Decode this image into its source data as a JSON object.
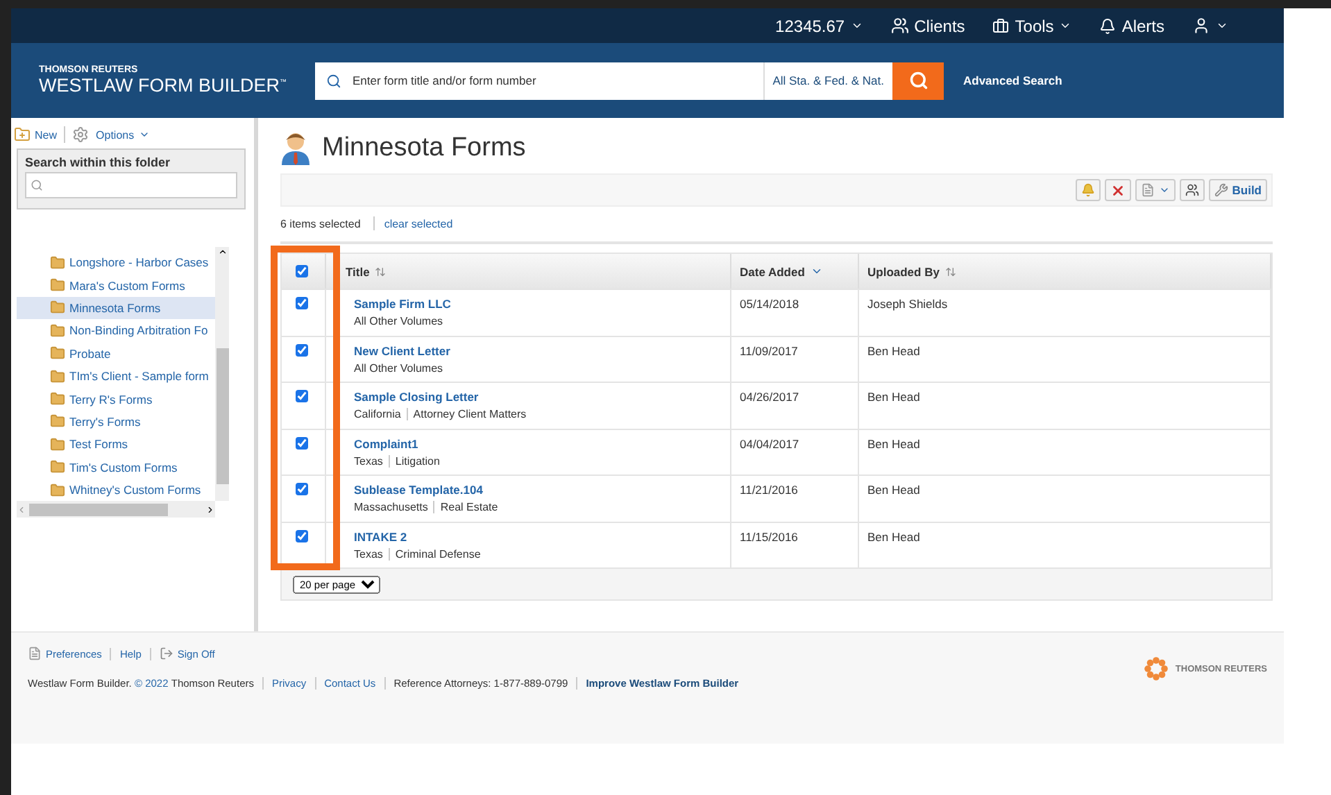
{
  "topbar": {
    "account": "12345.67",
    "items": [
      {
        "kind": "clients",
        "label": "Clients"
      },
      {
        "kind": "tools",
        "label": "Tools"
      },
      {
        "kind": "alerts",
        "label": "Alerts"
      },
      {
        "kind": "user"
      }
    ]
  },
  "header": {
    "brand_top": "THOMSON REUTERS",
    "brand": "WESTLAW FORM BUILDER",
    "tm": "™",
    "search": {
      "placeholder": "Enter form title and/or form number"
    },
    "scope": "All Sta. & Fed. & Nat.",
    "advanced": "Advanced Search"
  },
  "sidebar": {
    "new": "New",
    "options": "Options",
    "search_label": "Search within this folder",
    "folders": [
      {
        "name": "Longshore - Harbor Cases",
        "selected": false
      },
      {
        "name": "Mara's Custom Forms",
        "selected": false
      },
      {
        "name": "Minnesota Forms",
        "selected": true
      },
      {
        "name": "Non-Binding Arbitration Fo",
        "selected": false
      },
      {
        "name": "Probate",
        "selected": false
      },
      {
        "name": "TIm's Client - Sample form",
        "selected": false
      },
      {
        "name": "Terry R's Forms",
        "selected": false
      },
      {
        "name": "Terry's Forms",
        "selected": false
      },
      {
        "name": "Test Forms",
        "selected": false
      },
      {
        "name": "Tim's Custom Forms",
        "selected": false
      },
      {
        "name": "Whitney's Custom Forms",
        "selected": false
      }
    ]
  },
  "main": {
    "title": "Minnesota Forms",
    "build": "Build",
    "selected_count": "6 items selected",
    "clear": "clear selected",
    "all_checked": true,
    "columns": [
      {
        "label": "Title",
        "sorted": false
      },
      {
        "label": "Date Added",
        "sorted": true
      },
      {
        "label": "Uploaded By",
        "sorted": false
      }
    ],
    "rows": [
      {
        "checked": true,
        "title": "Sample Firm LLC",
        "tags": [
          "All Other Volumes"
        ],
        "date": "05/14/2018",
        "by": "Joseph Shields"
      },
      {
        "checked": true,
        "title": "New Client Letter",
        "tags": [
          "All Other Volumes"
        ],
        "date": "11/09/2017",
        "by": "Ben Head"
      },
      {
        "checked": true,
        "title": "Sample Closing Letter",
        "tags": [
          "California",
          "Attorney Client Matters"
        ],
        "date": "04/26/2017",
        "by": "Ben Head"
      },
      {
        "checked": true,
        "title": "Complaint1",
        "tags": [
          "Texas",
          "Litigation"
        ],
        "date": "04/04/2017",
        "by": "Ben Head"
      },
      {
        "checked": true,
        "title": "Sublease Template.104",
        "tags": [
          "Massachusetts",
          "Real Estate"
        ],
        "date": "11/21/2016",
        "by": "Ben Head"
      },
      {
        "checked": true,
        "title": "INTAKE 2",
        "tags": [
          "Texas",
          "Criminal Defense"
        ],
        "date": "11/15/2016",
        "by": "Ben Head"
      }
    ],
    "per_page": "20 per page"
  },
  "footer": {
    "links": [
      "Preferences",
      "Help",
      "Sign Off"
    ],
    "copyright_start": "Westlaw Form Builder.",
    "copyright_year": "© 2022",
    "copyright_end": "Thomson Reuters",
    "legal": [
      "Privacy",
      "Contact Us"
    ],
    "reference": "Reference Attorneys: 1-877-889-0799",
    "improve": "Improve Westlaw Form Builder",
    "logo_text": "THOMSON REUTERS"
  }
}
